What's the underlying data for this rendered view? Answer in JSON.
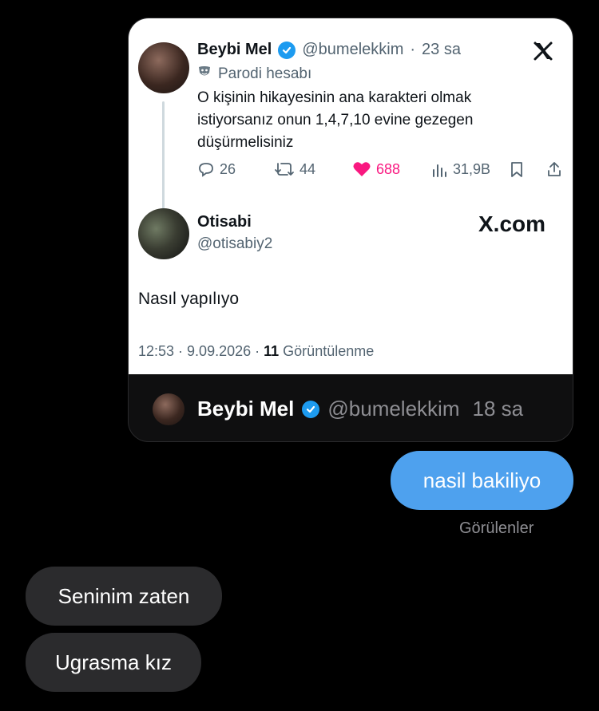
{
  "tweet": {
    "author_name": "Beybi Mel",
    "handle": "@bumelekkim",
    "time": "23 sa",
    "parody_label": "Parodi hesabı",
    "text_line1": "O kişinin hikayesinin ana karakteri olmak",
    "text_line2": "istiyorsanız onun 1,4,7,10 evine gezegen",
    "text_line3": "düşürmelisiniz",
    "replies": "26",
    "retweets": "44",
    "likes": "688",
    "views": "31,9B"
  },
  "reply": {
    "author_name": "Otisabi",
    "handle": "@otisabiy2",
    "text": "Nasıl yapılıyo",
    "timestamp": "12:53 · 9.09.2026 · ",
    "views_count": "11",
    "views_label": "Görüntülenme",
    "brand": "X.com"
  },
  "card_footer": {
    "author_name": "Beybi Mel",
    "handle": "@bumelekkim",
    "time": "18 sa"
  },
  "messages": {
    "outgoing": "nasil bakiliyo",
    "seen_label": "Görülenler",
    "incoming1": "Seninim zaten",
    "incoming2": "Ugrasma kız"
  },
  "colors": {
    "background": "#000000",
    "outgoing_bubble": "#4ea1ee",
    "incoming_bubble": "#2b2b2d",
    "verified": "#1d9bf0",
    "like": "#f91880"
  },
  "icons": [
    "x-logo-icon",
    "verified-badge-icon",
    "parody-mask-icon",
    "reply-icon",
    "retweet-icon",
    "heart-icon",
    "views-icon",
    "bookmark-icon",
    "share-icon"
  ]
}
